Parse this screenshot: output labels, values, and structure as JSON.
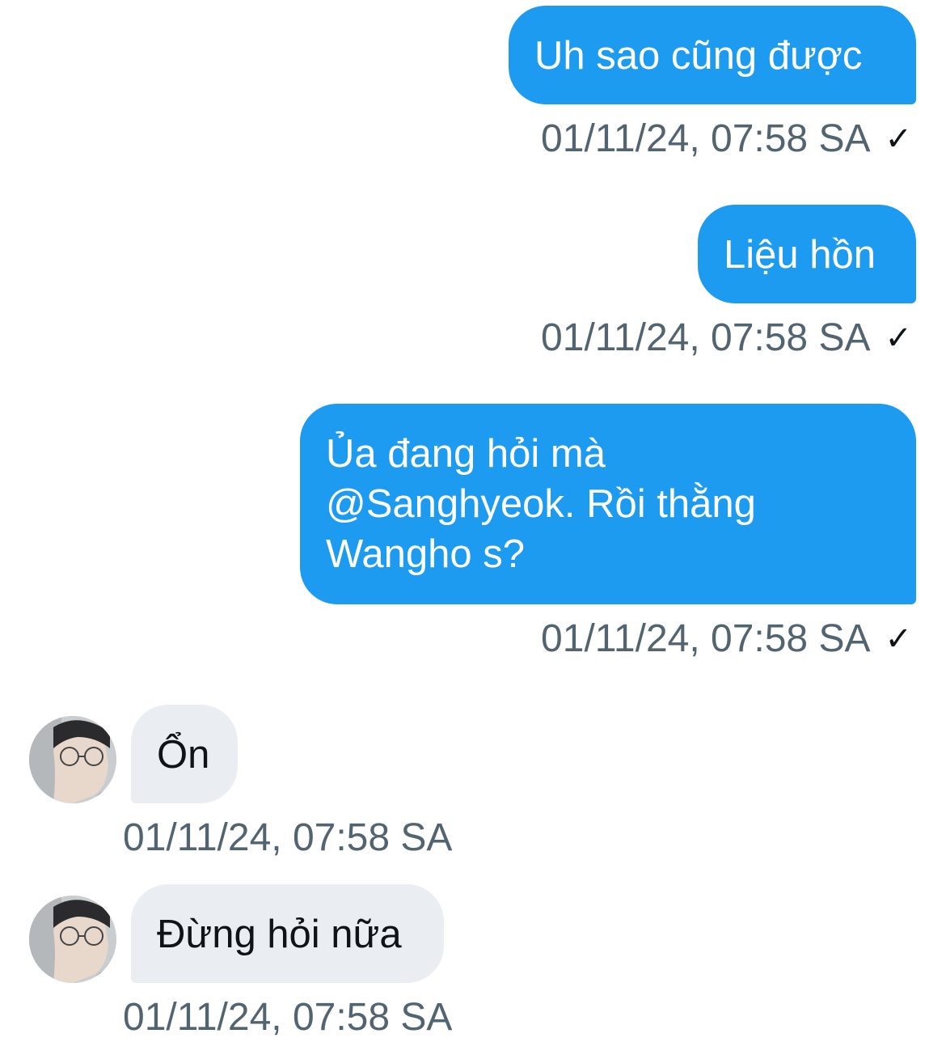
{
  "messages": [
    {
      "direction": "outgoing",
      "text": "Uh sao cũng được",
      "time": "01/11/24, 07:58 SA",
      "status_icon": "checkmark-icon",
      "status_glyph": "✓"
    },
    {
      "direction": "outgoing",
      "text": "Liệu hồn",
      "time": "01/11/24, 07:58 SA",
      "status_icon": "checkmark-icon",
      "status_glyph": "✓"
    },
    {
      "direction": "outgoing",
      "text_lines": [
        "Ủa đang hỏi mà",
        "@Sanghyeok. Rồi thằng",
        "Wangho s?"
      ],
      "time": "01/11/24, 07:58 SA",
      "status_icon": "checkmark-icon",
      "status_glyph": "✓"
    },
    {
      "direction": "incoming",
      "text": "Ổn",
      "time": "01/11/24, 07:58 SA",
      "avatar_icon": "avatar"
    },
    {
      "direction": "incoming",
      "text": "Đừng hỏi nữa",
      "time": "01/11/24, 07:58 SA",
      "avatar_icon": "avatar"
    }
  ],
  "colors": {
    "outgoing_bubble": "#1d9bf0",
    "incoming_bubble": "#eaedf1",
    "timestamp_text": "#536471"
  }
}
